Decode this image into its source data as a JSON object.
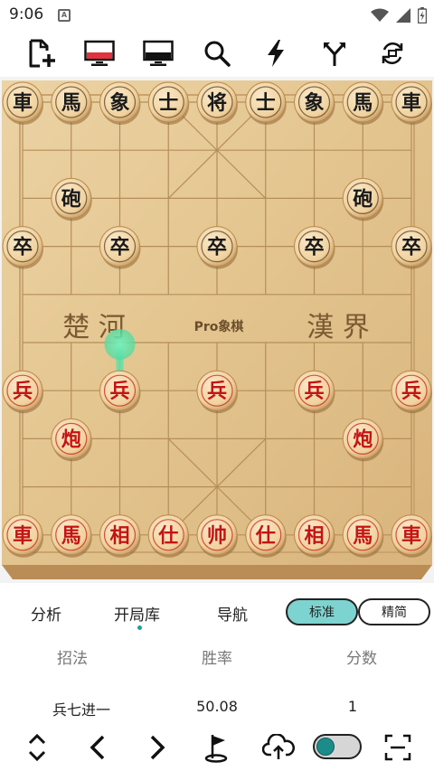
{
  "status_bar": {
    "time": "9:06",
    "notification_letter": "A"
  },
  "toolbar": {
    "icons": [
      "new-game-icon",
      "red-monitor-icon",
      "black-monitor-icon",
      "search-icon",
      "lightning-icon",
      "branch-icon",
      "rotate-icon"
    ]
  },
  "board": {
    "river_left": "楚 河",
    "river_center": "Pro象棋",
    "river_right": "漢 界",
    "colors": {
      "red": "#c41414",
      "black": "#1a1a1a",
      "wood": "#e6c896",
      "frame": "#c9a46e",
      "hint": "#5ee0a8"
    },
    "pieces": [
      {
        "side": "black",
        "char": "車",
        "file": 0,
        "rank": 0
      },
      {
        "side": "black",
        "char": "馬",
        "file": 1,
        "rank": 0
      },
      {
        "side": "black",
        "char": "象",
        "file": 2,
        "rank": 0
      },
      {
        "side": "black",
        "char": "士",
        "file": 3,
        "rank": 0
      },
      {
        "side": "black",
        "char": "将",
        "file": 4,
        "rank": 0
      },
      {
        "side": "black",
        "char": "士",
        "file": 5,
        "rank": 0
      },
      {
        "side": "black",
        "char": "象",
        "file": 6,
        "rank": 0
      },
      {
        "side": "black",
        "char": "馬",
        "file": 7,
        "rank": 0
      },
      {
        "side": "black",
        "char": "車",
        "file": 8,
        "rank": 0
      },
      {
        "side": "black",
        "char": "砲",
        "file": 1,
        "rank": 2
      },
      {
        "side": "black",
        "char": "砲",
        "file": 7,
        "rank": 2
      },
      {
        "side": "black",
        "char": "卒",
        "file": 0,
        "rank": 3
      },
      {
        "side": "black",
        "char": "卒",
        "file": 2,
        "rank": 3
      },
      {
        "side": "black",
        "char": "卒",
        "file": 4,
        "rank": 3
      },
      {
        "side": "black",
        "char": "卒",
        "file": 6,
        "rank": 3
      },
      {
        "side": "black",
        "char": "卒",
        "file": 8,
        "rank": 3
      },
      {
        "side": "red",
        "char": "兵",
        "file": 0,
        "rank": 6
      },
      {
        "side": "red",
        "char": "兵",
        "file": 2,
        "rank": 6
      },
      {
        "side": "red",
        "char": "兵",
        "file": 4,
        "rank": 6
      },
      {
        "side": "red",
        "char": "兵",
        "file": 6,
        "rank": 6
      },
      {
        "side": "red",
        "char": "兵",
        "file": 8,
        "rank": 6
      },
      {
        "side": "red",
        "char": "炮",
        "file": 1,
        "rank": 7
      },
      {
        "side": "red",
        "char": "炮",
        "file": 7,
        "rank": 7
      },
      {
        "side": "red",
        "char": "車",
        "file": 0,
        "rank": 9
      },
      {
        "side": "red",
        "char": "馬",
        "file": 1,
        "rank": 9
      },
      {
        "side": "red",
        "char": "相",
        "file": 2,
        "rank": 9
      },
      {
        "side": "red",
        "char": "仕",
        "file": 3,
        "rank": 9
      },
      {
        "side": "red",
        "char": "帅",
        "file": 4,
        "rank": 9
      },
      {
        "side": "red",
        "char": "仕",
        "file": 5,
        "rank": 9
      },
      {
        "side": "red",
        "char": "相",
        "file": 6,
        "rank": 9
      },
      {
        "side": "red",
        "char": "馬",
        "file": 7,
        "rank": 9
      },
      {
        "side": "red",
        "char": "車",
        "file": 8,
        "rank": 9
      }
    ],
    "hint_arrow": {
      "from": {
        "file": 2,
        "rank": 6
      },
      "to": {
        "file": 2,
        "rank": 5
      }
    }
  },
  "tabs": {
    "analysis": "分析",
    "opening_book": "开局库",
    "navigation": "导航",
    "mode_standard": "标准",
    "mode_simple": "精简"
  },
  "move_table": {
    "headers": [
      "招法",
      "胜率",
      "分数"
    ],
    "rows": [
      [
        "兵七进一",
        "50.08",
        "1"
      ]
    ]
  },
  "bottom_bar": {
    "icons": [
      "expand-collapse-icon",
      "previous-icon",
      "next-icon",
      "flag-icon",
      "upload-cloud-icon",
      "toggle-switch",
      "scan-icon"
    ]
  }
}
